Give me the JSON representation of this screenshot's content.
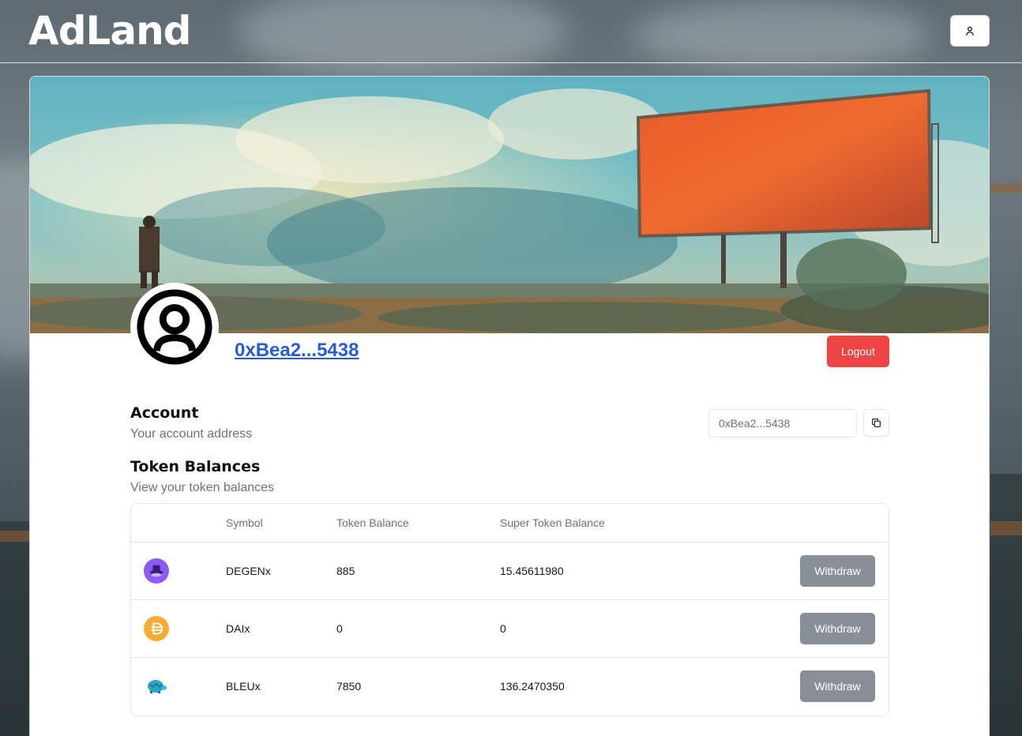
{
  "header": {
    "logo": "AdLand",
    "user_icon": "user-icon"
  },
  "profile": {
    "banner_alt": "billboard-landscape-illustration",
    "avatar_icon": "user-circle-icon",
    "address": "0xBea2...5438",
    "logout_label": "Logout"
  },
  "account": {
    "title": "Account",
    "subtitle": "Your account address",
    "address_value": "0xBea2...5438",
    "copy_icon": "copy-icon"
  },
  "tokens": {
    "title": "Token Balances",
    "subtitle": "View your token balances",
    "columns": [
      "",
      "Symbol",
      "Token Balance",
      "Super Token Balance"
    ],
    "rows": [
      {
        "icon": "degen-hat-icon",
        "symbol": "DEGENx",
        "token_balance": "885",
        "super_balance": "15.45611980",
        "action": "Withdraw"
      },
      {
        "icon": "dai-coin-icon",
        "symbol": "DAIx",
        "token_balance": "0",
        "super_balance": "0",
        "action": "Withdraw"
      },
      {
        "icon": "bleu-turtle-icon",
        "symbol": "BLEUx",
        "token_balance": "7850",
        "super_balance": "136.2470350",
        "action": "Withdraw"
      }
    ]
  },
  "colors": {
    "accent_link": "#2a5bd7",
    "logout": "#ef4444",
    "withdraw": "#8a8f97"
  }
}
